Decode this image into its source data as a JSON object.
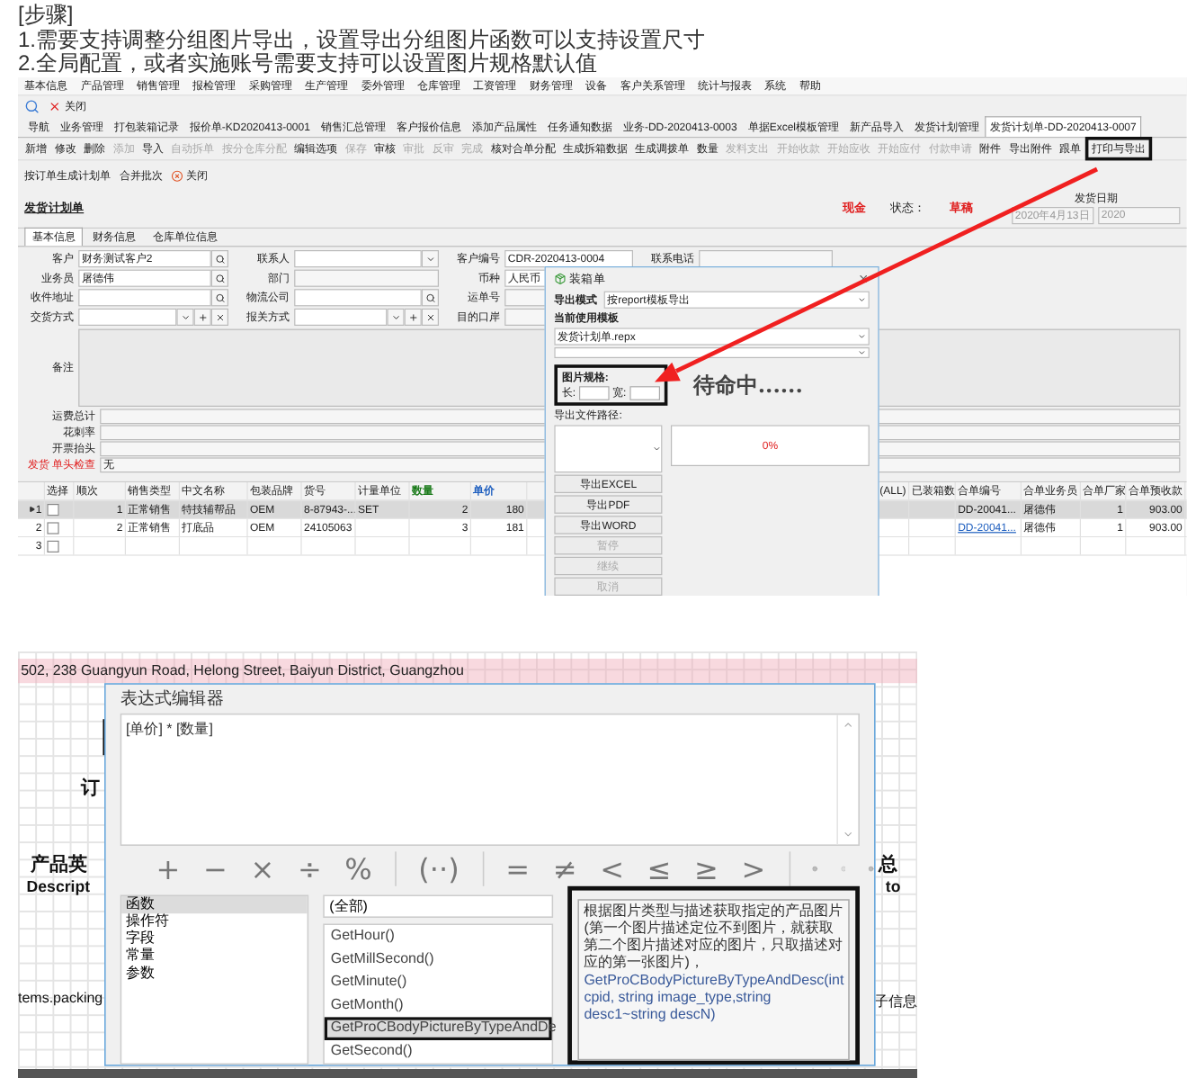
{
  "steps": {
    "heading": "[步骤]",
    "lines": [
      "1.需要支持调整分组图片导出，设置导出分组图片函数可以支持设置尺寸",
      "2.全局配置，或者实施账号需要支持可以设置图片规格默认值"
    ]
  },
  "erp": {
    "menu": [
      "基本信息",
      "产品管理",
      "销售管理",
      "报检管理",
      "采购管理",
      "生产管理",
      "委外管理",
      "仓库管理",
      "工资管理",
      "财务管理",
      "设备",
      "客户关系管理",
      "统计与报表",
      "系统",
      "帮助"
    ],
    "close_label": "关闭",
    "doc_tabs": [
      {
        "label": "导航",
        "selected": false
      },
      {
        "label": "业务管理",
        "selected": false
      },
      {
        "label": "打包装箱记录",
        "selected": false
      },
      {
        "label": "报价单-KD2020413-0001",
        "selected": false
      },
      {
        "label": "销售汇总管理",
        "selected": false
      },
      {
        "label": "客户报价信息",
        "selected": false
      },
      {
        "label": "添加产品属性",
        "selected": false
      },
      {
        "label": "任务通知数据",
        "selected": false
      },
      {
        "label": "业务-DD-2020413-0003",
        "selected": false
      },
      {
        "label": "单据Excel模板管理",
        "selected": false
      },
      {
        "label": "新产品导入",
        "selected": false
      },
      {
        "label": "发货计划管理",
        "selected": false
      },
      {
        "label": "发货计划单-DD-2020413-0007",
        "selected": true
      }
    ],
    "actions": [
      {
        "label": "新增",
        "disabled": false,
        "annotated": false
      },
      {
        "label": "修改",
        "disabled": false,
        "annotated": false
      },
      {
        "label": "删除",
        "disabled": false,
        "annotated": false
      },
      {
        "label": "添加",
        "disabled": true,
        "annotated": false
      },
      {
        "label": "导入",
        "disabled": false,
        "annotated": false
      },
      {
        "label": "自动拆单",
        "disabled": true,
        "annotated": false
      },
      {
        "label": "按分仓库分配",
        "disabled": true,
        "annotated": false
      },
      {
        "label": "编辑选项",
        "disabled": false,
        "annotated": false
      },
      {
        "label": "保存",
        "disabled": true,
        "annotated": false
      },
      {
        "label": "审核",
        "disabled": false,
        "annotated": false
      },
      {
        "label": "审批",
        "disabled": true,
        "annotated": false
      },
      {
        "label": "反审",
        "disabled": true,
        "annotated": false
      },
      {
        "label": "完成",
        "disabled": true,
        "annotated": false
      },
      {
        "label": "核对合单分配",
        "disabled": false,
        "annotated": false
      },
      {
        "label": "生成拆箱数据",
        "disabled": false,
        "annotated": false
      },
      {
        "label": "生成调拨单",
        "disabled": false,
        "annotated": false
      },
      {
        "label": "数量",
        "disabled": false,
        "annotated": false
      },
      {
        "label": "发料支出",
        "disabled": true,
        "annotated": false
      },
      {
        "label": "开始收款",
        "disabled": true,
        "annotated": false
      },
      {
        "label": "开始应收",
        "disabled": true,
        "annotated": false
      },
      {
        "label": "开始应付",
        "disabled": true,
        "annotated": false
      },
      {
        "label": "付款申请",
        "disabled": true,
        "annotated": false
      },
      {
        "label": "附件",
        "disabled": false,
        "annotated": false
      },
      {
        "label": "导出附件",
        "disabled": false,
        "annotated": false
      },
      {
        "label": "跟单",
        "disabled": false,
        "annotated": false
      },
      {
        "label": "打印与导出",
        "disabled": false,
        "annotated": true
      }
    ],
    "sub_actions": [
      {
        "label": "按订单生成计划单",
        "kind": "plain"
      },
      {
        "label": "合并批次",
        "kind": "plain"
      },
      {
        "label": "关闭",
        "kind": "close"
      }
    ],
    "form_title": "发货计划单",
    "payment": "现金",
    "status_label": "状态：",
    "status": "草稿",
    "date": {
      "legend": "发货日期",
      "value": "2020年4月13日",
      "value_2": "2020"
    },
    "form_tabs": [
      {
        "label": "基本信息",
        "selected": true
      },
      {
        "label": "财务信息",
        "selected": false
      },
      {
        "label": "仓库单位信息",
        "selected": false
      }
    ],
    "field_rows": [
      [
        {
          "label": "客户",
          "value": "财务测试客户2",
          "kind": "lookup"
        },
        {
          "label": "联系人",
          "kind": "combo"
        },
        {
          "label": "客户编号",
          "value": "CDR-2020413-0004",
          "kind": "text"
        },
        {
          "label": "联系电话",
          "kind": "text"
        }
      ],
      [
        {
          "label": "业务员",
          "value": "屠德伟",
          "kind": "lookup"
        },
        {
          "label": "部门",
          "kind": "text"
        },
        {
          "label": "币种",
          "value": "人民币",
          "kind": "text"
        }
      ],
      [
        {
          "label": "收件地址",
          "kind": "lookup"
        },
        {
          "label": "物流公司",
          "kind": "lookup"
        },
        {
          "label": "运单号",
          "kind": "text"
        }
      ],
      [
        {
          "label": "交货方式",
          "kind": "plus"
        },
        {
          "label": "报关方式",
          "kind": "plus"
        },
        {
          "label": "目的口岸",
          "kind": "text"
        }
      ]
    ],
    "remarks_label": "备注",
    "extra_rows": [
      {
        "label": "运费总计",
        "alert": false
      },
      {
        "label": "花刺率",
        "alert": false
      },
      {
        "label": "开票抬头",
        "alert": false
      },
      {
        "label": "发货 单头检查",
        "value": "无",
        "alert": true
      }
    ],
    "table": {
      "select_label": "选择",
      "left_columns": [
        {
          "label": "顺次"
        },
        {
          "label": "销售类型"
        },
        {
          "label": "中文名称"
        },
        {
          "label": "包装品牌"
        },
        {
          "label": "货号"
        },
        {
          "label": "计量单位"
        },
        {
          "label": "数量",
          "color": "#1a7a1a"
        },
        {
          "label": "单价",
          "color": "#1f5fbf"
        }
      ],
      "right_columns": [
        {
          "label": "(ALL)"
        },
        {
          "label": "已装箱数"
        },
        {
          "label": "合单编号"
        },
        {
          "label": "合单业务员"
        },
        {
          "label": "合单厂家"
        },
        {
          "label": "合单预收款"
        }
      ],
      "rows": [
        {
          "number": "1",
          "selected": true,
          "checked": false,
          "linked": false,
          "left_cells": [
            "1",
            "正常销售",
            "特技辅帮品",
            "OEM",
            "8-87943-...",
            "SET",
            "2",
            "180"
          ],
          "right_cells": [
            null,
            null,
            "DD-20041...",
            "屠德伟",
            "1",
            "903.00"
          ]
        },
        {
          "number": "2",
          "selected": false,
          "checked": false,
          "linked": true,
          "left_cells": [
            "2",
            "正常销售",
            "打底品",
            "OEM",
            "24105063",
            null,
            "3",
            "181"
          ],
          "right_cells": [
            null,
            null,
            "DD-20041...",
            "屠德伟",
            "1",
            "903.00"
          ]
        },
        {
          "number": "3",
          "selected": false,
          "checked": false
        }
      ]
    },
    "dialog": {
      "title": "装箱单",
      "mode_label": "导出模式",
      "mode": "按report模板导出",
      "template_label": "当前使用模板",
      "template": "发货计划单.repx",
      "size_label": "图片规格:",
      "length_label": "长:",
      "width_label": "宽:",
      "size_annotated": true,
      "status": "待命中......",
      "path_label": "导出文件路径:",
      "progress": {
        "level": 0,
        "reading": "0%"
      },
      "buttons": [
        {
          "label": "导出EXCEL",
          "disabled": false
        },
        {
          "label": "导出PDF",
          "disabled": false
        },
        {
          "label": "导出WORD",
          "disabled": false
        },
        {
          "label": "暂停",
          "disabled": true
        },
        {
          "label": "继续",
          "disabled": true
        },
        {
          "label": "取消",
          "disabled": true
        }
      ]
    }
  },
  "report": {
    "address": "502, 238 Guangyun Road, Helong Street, Baiyun District, Guangzhou",
    "left_texts": [
      "订",
      "产品英",
      "Descript",
      "tems.packing"
    ],
    "right_texts": [
      "总",
      "to",
      "子信息"
    ],
    "editor": {
      "title": "表达式编辑器",
      "expression": "[单价] * [数量]",
      "operator_groups": [
        [
          "+",
          "−",
          "×",
          "÷",
          "%"
        ],
        [
          "(··)"
        ],
        [
          "=",
          "≠",
          "<",
          "≤",
          "≥",
          ">"
        ]
      ],
      "categories": [
        {
          "label": "函数",
          "selected": true
        },
        {
          "label": "操作符",
          "selected": false
        },
        {
          "label": "字段",
          "selected": false
        },
        {
          "label": "常量",
          "selected": false
        },
        {
          "label": "参数",
          "selected": false
        }
      ],
      "filter": "(全部)",
      "functions": [
        {
          "label": "GetHour()",
          "selected": false,
          "annotated": false
        },
        {
          "label": "GetMillSecond()",
          "selected": false,
          "annotated": false
        },
        {
          "label": "GetMinute()",
          "selected": false,
          "annotated": false
        },
        {
          "label": "GetMonth()",
          "selected": false,
          "annotated": false
        },
        {
          "label": "GetProCBodyPictureByTypeAndDe",
          "selected": true,
          "annotated": true
        },
        {
          "label": "GetSecond()",
          "selected": false,
          "annotated": false
        }
      ],
      "description": "根据图片类型与描述获取指定的产品图片(第一个图片描述定位不到图片，就获取第二个图片描述对应的图片，只取描述对应的第一张图片)，",
      "signature": "GetProCBodyPictureByTypeAndDesc(int cpid, string image_type,string desc1~string descN)",
      "description_annotated": true
    }
  }
}
